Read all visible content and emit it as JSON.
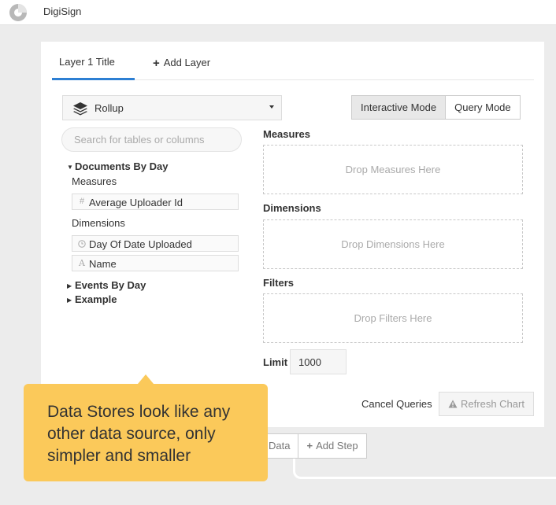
{
  "app": {
    "title": "DigiSign"
  },
  "tabs": [
    {
      "label": "Layer 1 Title",
      "active": true
    },
    {
      "label": "Add Layer"
    }
  ],
  "source_select": {
    "value": "Rollup",
    "icon": "layers-icon"
  },
  "modes": {
    "interactive": "Interactive Mode",
    "query": "Query Mode",
    "active": "interactive"
  },
  "search": {
    "placeholder": "Search for tables or columns"
  },
  "tree": {
    "documents": {
      "label": "Documents By Day",
      "measures_label": "Measures",
      "measures": [
        {
          "label": "Average Uploader Id",
          "icon": "#"
        }
      ],
      "dimensions_label": "Dimensions",
      "dimensions": [
        {
          "label": "Day Of Date Uploaded",
          "icon": "clock"
        },
        {
          "label": "Name",
          "icon": "A"
        }
      ]
    },
    "events": {
      "label": "Events By Day"
    },
    "example": {
      "label": "Example"
    }
  },
  "sections": {
    "measures": {
      "label": "Measures",
      "drop": "Drop Measures Here"
    },
    "dimensions": {
      "label": "Dimensions",
      "drop": "Drop Dimensions Here"
    },
    "filters": {
      "label": "Filters",
      "drop": "Drop Filters Here"
    }
  },
  "limit": {
    "label": "Limit",
    "value": "1000"
  },
  "actions": {
    "cancel": "Cancel Queries",
    "refresh": "Refresh Chart"
  },
  "steps": {
    "data": "Data",
    "add_step": "Add Step"
  },
  "tooltip": {
    "lines": [
      "Data Stores look like any",
      "other data source, only",
      "simpler and smaller"
    ]
  },
  "colors": {
    "accent": "#2d7fd3",
    "tooltip": "#fbc95a"
  }
}
